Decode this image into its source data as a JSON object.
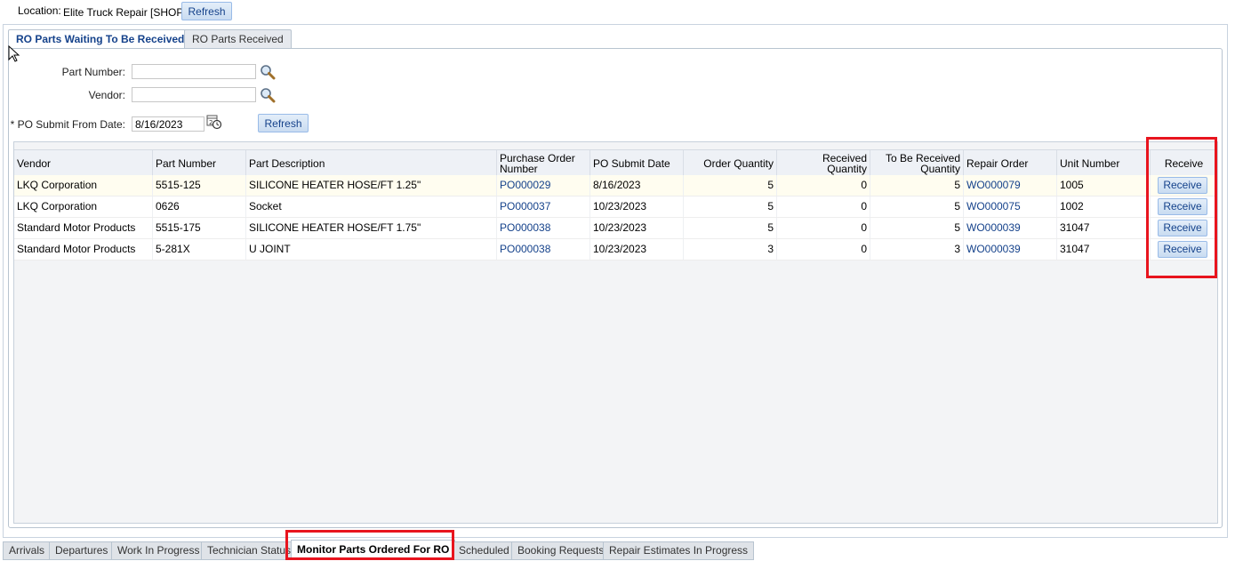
{
  "header": {
    "location_label": "Location:",
    "location_value": "Elite Truck Repair [SHOP]",
    "refresh_label": "Refresh"
  },
  "tabs": [
    {
      "label": "RO Parts Waiting To Be Received",
      "active": true
    },
    {
      "label": "RO Parts Received",
      "active": false
    }
  ],
  "filters": {
    "part_number_label": "Part Number:",
    "part_number_value": "",
    "vendor_label": "Vendor:",
    "vendor_value": "",
    "po_date_label": "* PO Submit From Date:",
    "po_date_value": "8/16/2023",
    "refresh_label": "Refresh"
  },
  "grid": {
    "columns": [
      "Vendor",
      "Part Number",
      "Part Description",
      "Purchase Order Number",
      "PO Submit Date",
      "Order Quantity",
      "Received Quantity",
      "To Be Received Quantity",
      "Repair Order",
      "Unit Number",
      "Receive"
    ],
    "rows": [
      {
        "vendor": "LKQ Corporation",
        "part_number": "5515-125",
        "description": "SILICONE HEATER HOSE/FT 1.25\"",
        "po": "PO000029",
        "po_date": "8/16/2023",
        "order_qty": "5",
        "received_qty": "0",
        "to_receive": "5",
        "repair_order": "WO000079",
        "unit": "1005",
        "action": "Receive"
      },
      {
        "vendor": "LKQ Corporation",
        "part_number": "0626",
        "description": "Socket",
        "po": "PO000037",
        "po_date": "10/23/2023",
        "order_qty": "5",
        "received_qty": "0",
        "to_receive": "5",
        "repair_order": "WO000075",
        "unit": "1002",
        "action": "Receive"
      },
      {
        "vendor": "Standard Motor Products",
        "part_number": "5515-175",
        "description": "SILICONE HEATER HOSE/FT 1.75\"",
        "po": "PO000038",
        "po_date": "10/23/2023",
        "order_qty": "5",
        "received_qty": "0",
        "to_receive": "5",
        "repair_order": "WO000039",
        "unit": "31047",
        "action": "Receive"
      },
      {
        "vendor": "Standard Motor Products",
        "part_number": "5-281X",
        "description": "U JOINT",
        "po": "PO000038",
        "po_date": "10/23/2023",
        "order_qty": "3",
        "received_qty": "0",
        "to_receive": "3",
        "repair_order": "WO000039",
        "unit": "31047",
        "action": "Receive"
      }
    ]
  },
  "bottom_tabs": [
    {
      "label": "Arrivals",
      "active": false
    },
    {
      "label": "Departures",
      "active": false
    },
    {
      "label": "Work In Progress",
      "active": false
    },
    {
      "label": "Technician Status",
      "active": false
    },
    {
      "label": "Monitor Parts Ordered For RO",
      "active": true
    },
    {
      "label": "Scheduled",
      "active": false
    },
    {
      "label": "Booking Requests",
      "active": false
    },
    {
      "label": "Repair Estimates In Progress",
      "active": false
    }
  ],
  "colors": {
    "accent": "#15428b",
    "highlight": "#e8141e"
  }
}
